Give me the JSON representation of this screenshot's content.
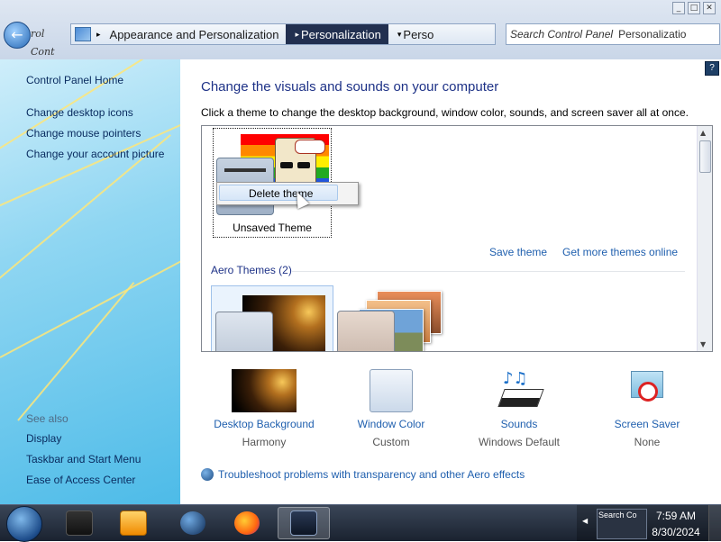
{
  "window": {
    "back_hint": "Back",
    "back_label": "rol Cont",
    "minimize": "_",
    "maximize": "□",
    "close": "✕"
  },
  "addressbar": {
    "icon": "control-panel-icon",
    "crumbs": [
      "Appearance and Personalization",
      "Personalization",
      "Perso"
    ],
    "crumb_arrows": [
      "▸",
      "▸",
      "▾"
    ]
  },
  "search": {
    "placeholder": "Search Control Panel",
    "overlay_text": "Personalizatio"
  },
  "left_pane": {
    "home": "Control Panel Home",
    "links": [
      "Change desktop icons",
      "Change mouse pointers",
      "Change your account picture"
    ],
    "see_also_label": "See also",
    "see_also": [
      "Display",
      "Taskbar and Start Menu",
      "Ease of Access Center"
    ]
  },
  "main": {
    "heading": "Change the visuals and sounds on your computer",
    "subtitle": "Click a theme to change the desktop background, window color, sounds, and screen saver all at once.",
    "help": "?",
    "unsaved_theme": "Unsaved Theme",
    "context_menu": {
      "delete_theme": "Delete theme"
    },
    "save_theme": "Save theme",
    "get_more_themes": "Get more themes online",
    "aero_header": "Aero Themes (2)",
    "scroll_up": "▲",
    "scroll_down": "▼"
  },
  "settings": [
    {
      "label": "Desktop Background",
      "value": "Harmony",
      "icon": "desktop-background-icon"
    },
    {
      "label": "Window Color",
      "value": "Custom",
      "icon": "window-color-icon"
    },
    {
      "label": "Sounds",
      "value": "Windows Default",
      "icon": "sounds-icon"
    },
    {
      "label": "Screen Saver",
      "value": "None",
      "icon": "screen-saver-icon"
    }
  ],
  "troubleshoot": "Troubleshoot problems with transparency and other Aero effects",
  "taskbar": {
    "apps": [
      "media-app-icon",
      "media-player-icon",
      "globe-icon",
      "firefox-icon",
      "control-panel-icon"
    ],
    "tray_arrow": "◀",
    "tray_thumb_text": "Search Co",
    "time": "7:59 AM",
    "date": "8/30/2024"
  },
  "colors": {
    "link": "#1f5fae",
    "heading": "#1e3287",
    "taskbar": "#1a2230",
    "left_pane": "#4dbbe8"
  }
}
